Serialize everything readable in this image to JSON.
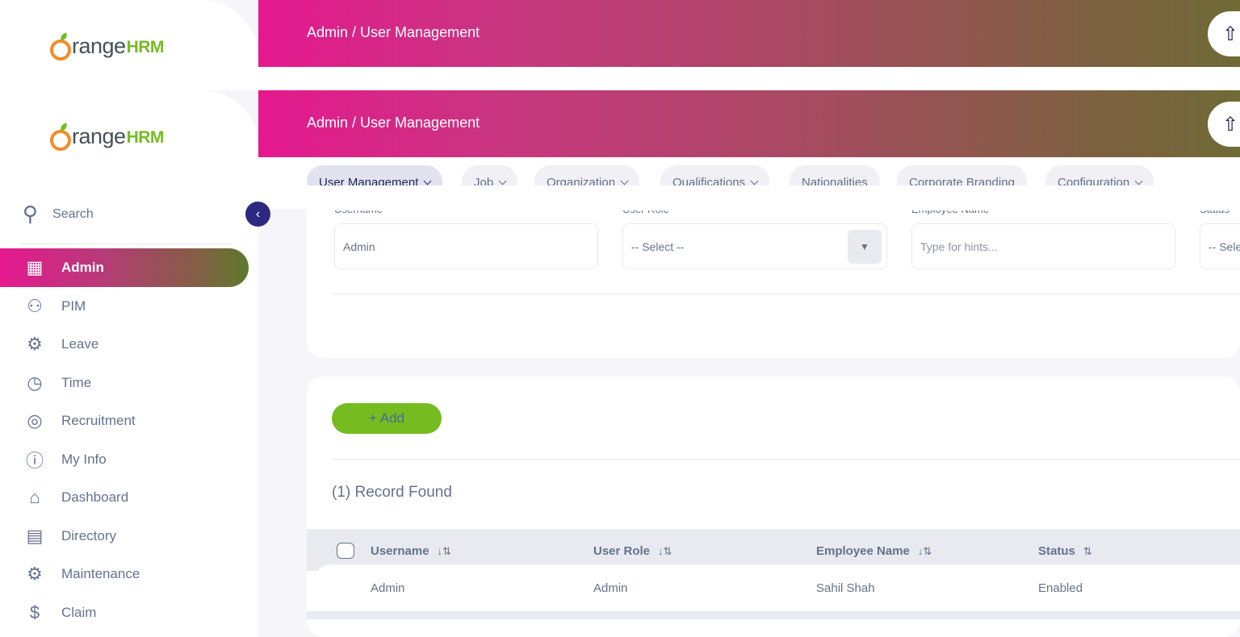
{
  "brand": {
    "logo_text": "range",
    "logo_suffix": "HRM"
  },
  "header": {
    "breadcrumb": "Admin / User Management"
  },
  "top_tabs": [
    {
      "label": "User Management",
      "active": true,
      "dropdown": true
    },
    {
      "label": "Job",
      "active": false,
      "dropdown": true
    },
    {
      "label": "Organization",
      "active": false,
      "dropdown": true
    },
    {
      "label": "Qualifications",
      "active": false,
      "dropdown": true
    },
    {
      "label": "Nationalities",
      "active": false,
      "dropdown": false
    },
    {
      "label": "Corporate Branding",
      "active": false,
      "dropdown": false
    },
    {
      "label": "Configuration",
      "active": false,
      "dropdown": true
    }
  ],
  "sidebar": {
    "search_label": "Search",
    "items": [
      {
        "label": "Admin",
        "icon": "admin-icon",
        "active": true
      },
      {
        "label": "PIM",
        "icon": "pim-icon",
        "active": false
      },
      {
        "label": "Leave",
        "icon": "leave-icon",
        "active": false
      },
      {
        "label": "Time",
        "icon": "time-icon",
        "active": false
      },
      {
        "label": "Recruitment",
        "icon": "recruitment-icon",
        "active": false
      },
      {
        "label": "My Info",
        "icon": "my-info-icon",
        "active": false
      },
      {
        "label": "Dashboard",
        "icon": "dashboard-icon",
        "active": false
      },
      {
        "label": "Directory",
        "icon": "directory-icon",
        "active": false
      },
      {
        "label": "Maintenance",
        "icon": "maintenance-icon",
        "active": false
      },
      {
        "label": "Claim",
        "icon": "claim-icon",
        "active": false
      }
    ]
  },
  "filters": {
    "username_label": "Username",
    "username_value": "Admin",
    "user_role_label": "User Role",
    "user_role_value": "-- Select --",
    "employee_name_label": "Employee Name",
    "employee_name_placeholder": "Type for hints...",
    "status_label": "Status",
    "status_value": "-- Sele"
  },
  "actions": {
    "add_label": "+ Add"
  },
  "records": {
    "count_text": "(1) Record Found"
  },
  "table": {
    "columns": [
      "Username",
      "User Role",
      "Employee Name",
      "Status"
    ],
    "rows": [
      [
        "Admin",
        "Admin",
        "Sahil Shah",
        "Enabled"
      ]
    ]
  },
  "colors": {
    "brand_green": "#76bc21",
    "brand_orange": "#f28c28",
    "gradient_start": "#e5188f",
    "gradient_end": "#6f6a36",
    "collapse_button": "#2d2880"
  }
}
